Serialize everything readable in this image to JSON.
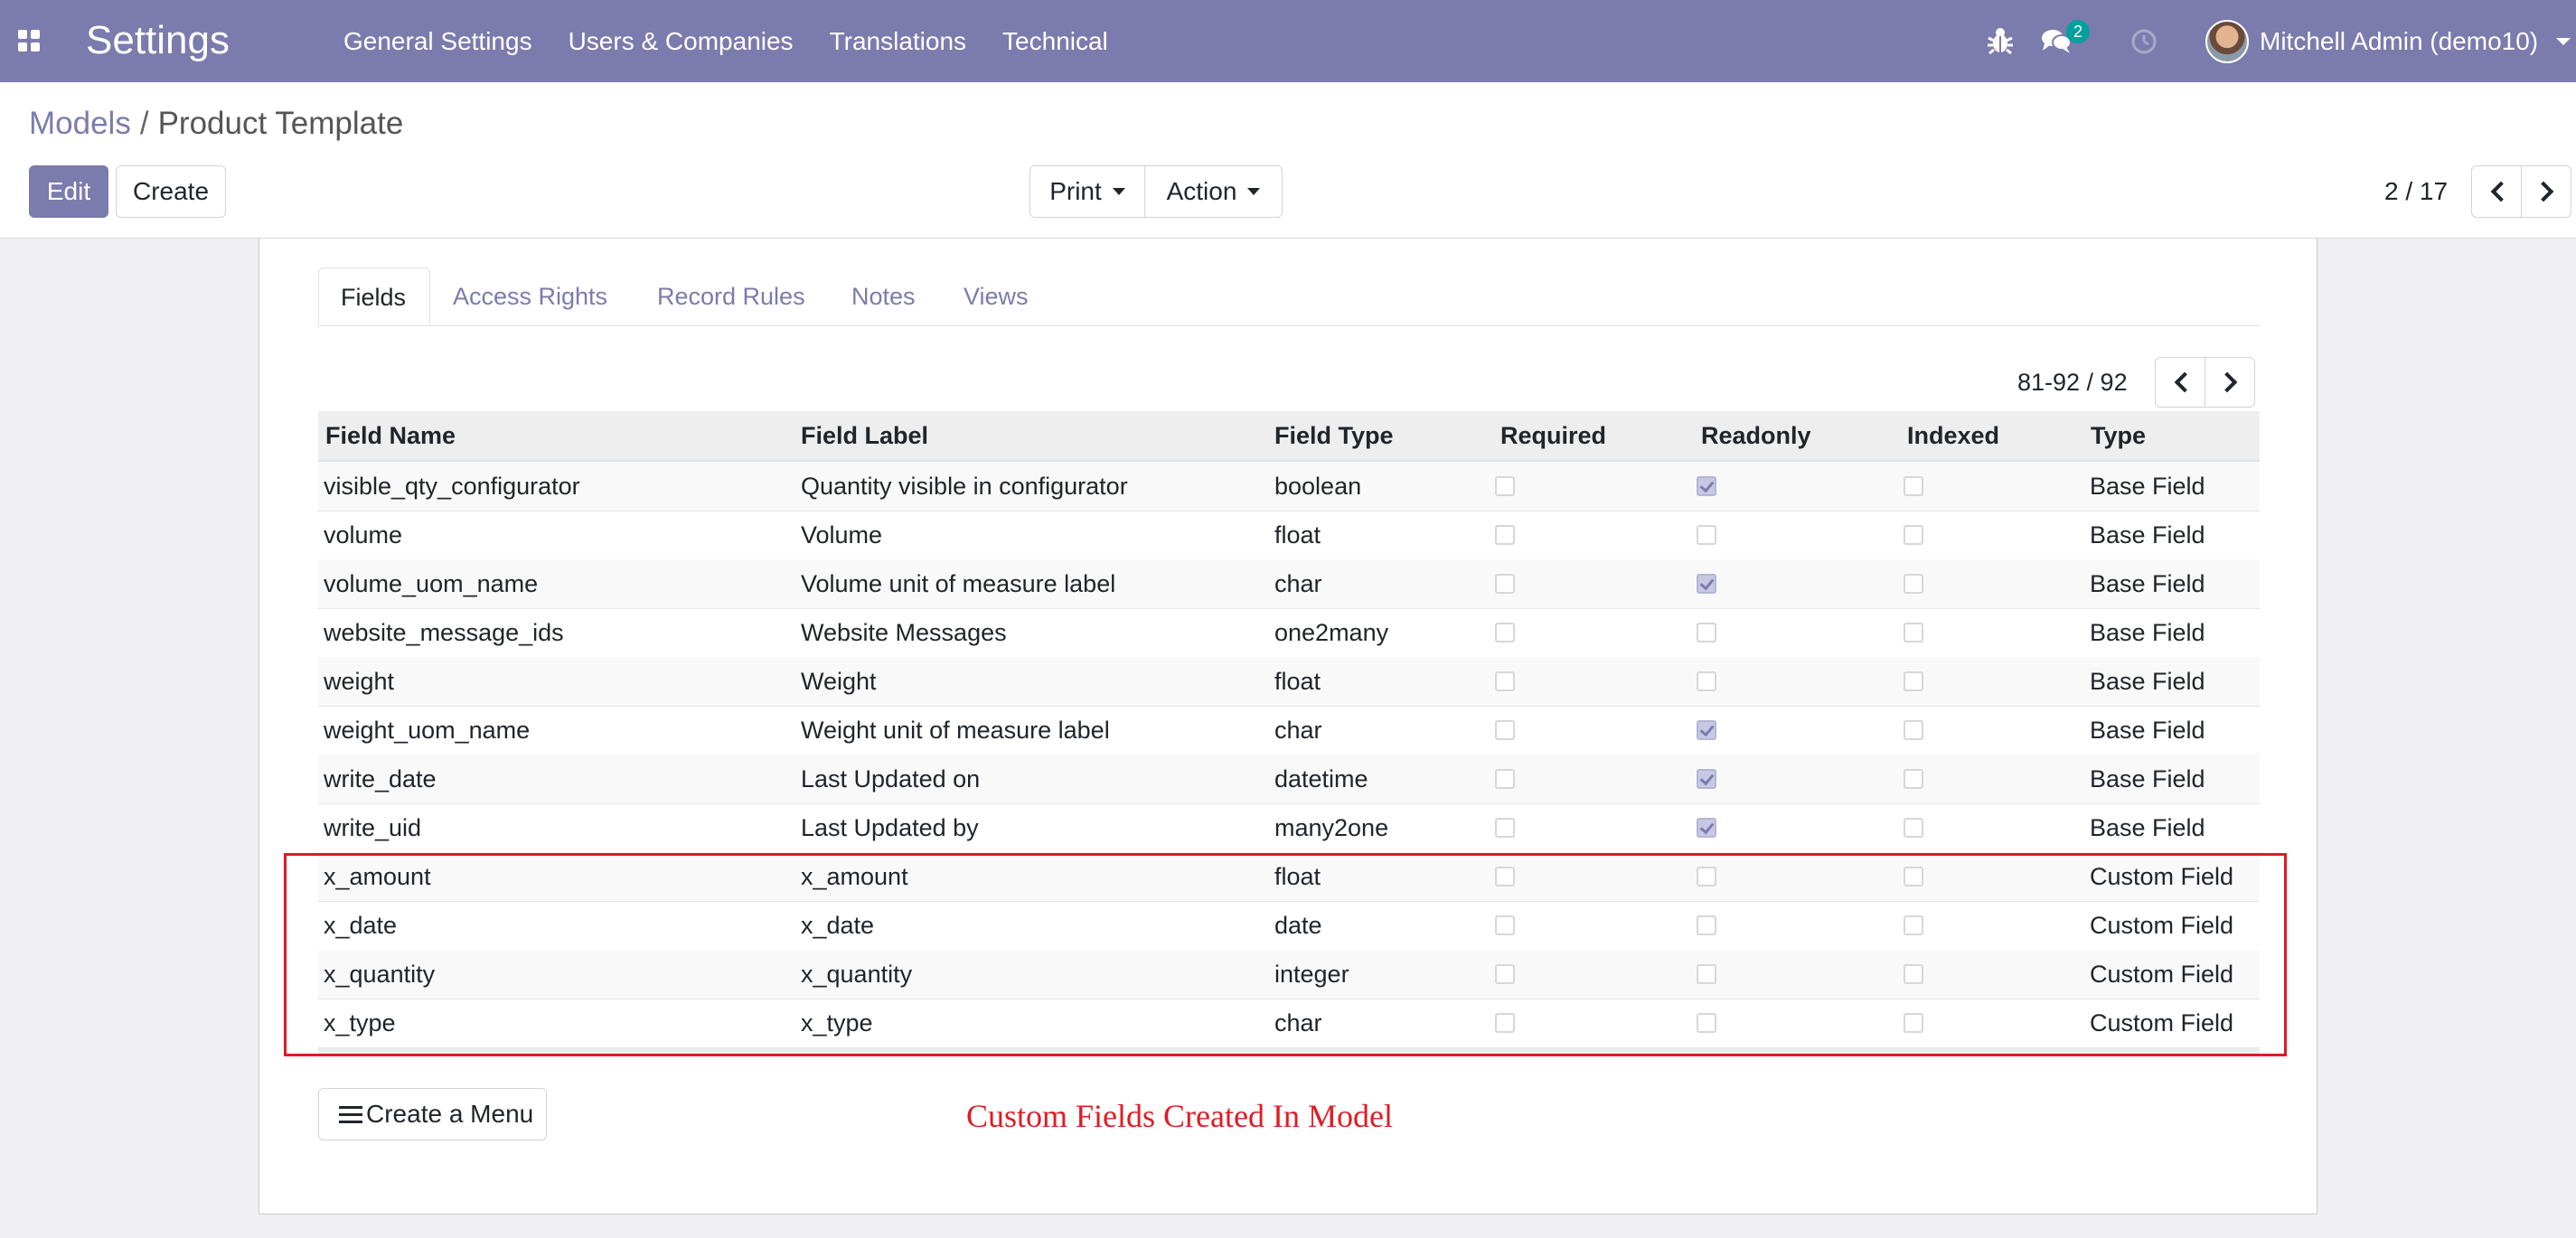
{
  "navbar": {
    "brand": "Settings",
    "menu": [
      "General Settings",
      "Users & Companies",
      "Translations",
      "Technical"
    ],
    "message_count": "2",
    "user": "Mitchell Admin (demo10)",
    "color": "#7c7bad"
  },
  "breadcrumb": {
    "parent": "Models",
    "separator": "/",
    "current": "Product Template"
  },
  "buttons": {
    "edit": "Edit",
    "create": "Create",
    "print": "Print",
    "action": "Action",
    "create_menu": "Create a Menu"
  },
  "pager": {
    "label": "2 / 17"
  },
  "tabs": [
    "Fields",
    "Access Rights",
    "Record Rules",
    "Notes",
    "Views"
  ],
  "list_pager": {
    "label": "81-92 / 92"
  },
  "columns": [
    "Field Name",
    "Field Label",
    "Field Type",
    "Required",
    "Readonly",
    "Indexed",
    "Type"
  ],
  "rows": [
    {
      "name": "visible_qty_configurator",
      "label": "Quantity visible in configurator",
      "ftype": "boolean",
      "required": false,
      "readonly": true,
      "indexed": false,
      "type": "Base Field"
    },
    {
      "name": "volume",
      "label": "Volume",
      "ftype": "float",
      "required": false,
      "readonly": false,
      "indexed": false,
      "type": "Base Field"
    },
    {
      "name": "volume_uom_name",
      "label": "Volume unit of measure label",
      "ftype": "char",
      "required": false,
      "readonly": true,
      "indexed": false,
      "type": "Base Field"
    },
    {
      "name": "website_message_ids",
      "label": "Website Messages",
      "ftype": "one2many",
      "required": false,
      "readonly": false,
      "indexed": false,
      "type": "Base Field"
    },
    {
      "name": "weight",
      "label": "Weight",
      "ftype": "float",
      "required": false,
      "readonly": false,
      "indexed": false,
      "type": "Base Field"
    },
    {
      "name": "weight_uom_name",
      "label": "Weight unit of measure label",
      "ftype": "char",
      "required": false,
      "readonly": true,
      "indexed": false,
      "type": "Base Field"
    },
    {
      "name": "write_date",
      "label": "Last Updated on",
      "ftype": "datetime",
      "required": false,
      "readonly": true,
      "indexed": false,
      "type": "Base Field"
    },
    {
      "name": "write_uid",
      "label": "Last Updated by",
      "ftype": "many2one",
      "required": false,
      "readonly": true,
      "indexed": false,
      "type": "Base Field"
    },
    {
      "name": "x_amount",
      "label": "x_amount",
      "ftype": "float",
      "required": false,
      "readonly": false,
      "indexed": false,
      "type": "Custom Field"
    },
    {
      "name": "x_date",
      "label": "x_date",
      "ftype": "date",
      "required": false,
      "readonly": false,
      "indexed": false,
      "type": "Custom Field"
    },
    {
      "name": "x_quantity",
      "label": "x_quantity",
      "ftype": "integer",
      "required": false,
      "readonly": false,
      "indexed": false,
      "type": "Custom Field"
    },
    {
      "name": "x_type",
      "label": "x_type",
      "ftype": "char",
      "required": false,
      "readonly": false,
      "indexed": false,
      "type": "Custom Field"
    }
  ],
  "annotation": "Custom Fields Created In Model",
  "annotation_color": "#e01b24"
}
